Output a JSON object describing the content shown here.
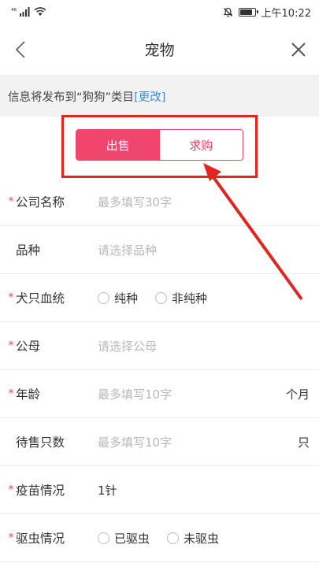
{
  "statusbar": {
    "signal": "⁴⁶",
    "time": "上午10:22"
  },
  "navbar": {
    "title": "宠物"
  },
  "info": {
    "text": "信息将发布到“狗狗”类目",
    "link": "[更改]"
  },
  "segment": {
    "sell": "出售",
    "buy": "求购"
  },
  "form": {
    "company": {
      "label": "公司名称",
      "placeholder": "最多填写30字"
    },
    "breed": {
      "label": "品种",
      "placeholder": "请选择品种"
    },
    "bloodline": {
      "label": "犬只血统",
      "options": [
        "纯种",
        "非纯种"
      ]
    },
    "gender": {
      "label": "公母",
      "placeholder": "请选择公母"
    },
    "age": {
      "label": "年龄",
      "placeholder": "最多填写10字",
      "unit": "个月"
    },
    "quantity": {
      "label": "待售只数",
      "placeholder": "最多填写10字",
      "unit": "只"
    },
    "vaccine": {
      "label": "疫苗情况",
      "value": "1针"
    },
    "deworm": {
      "label": "驱虫情况",
      "options": [
        "已驱虫",
        "未驱虫"
      ]
    }
  },
  "colors": {
    "accent": "#f0466d",
    "annotation": "#e4251f",
    "link": "#3b8be0"
  }
}
